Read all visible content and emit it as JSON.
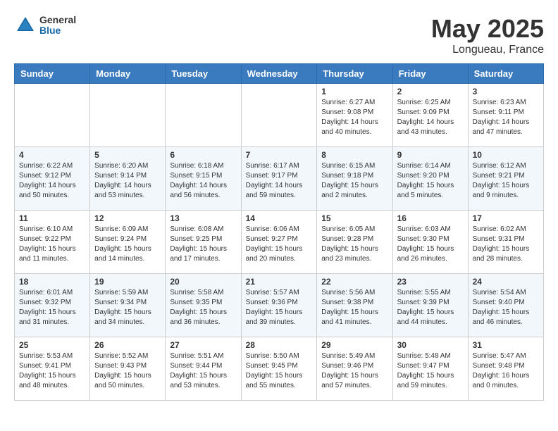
{
  "header": {
    "logo_general": "General",
    "logo_blue": "Blue",
    "title": "May 2025",
    "subtitle": "Longueau, France"
  },
  "calendar": {
    "days_of_week": [
      "Sunday",
      "Monday",
      "Tuesday",
      "Wednesday",
      "Thursday",
      "Friday",
      "Saturday"
    ],
    "weeks": [
      {
        "days": [
          {
            "number": "",
            "info": ""
          },
          {
            "number": "",
            "info": ""
          },
          {
            "number": "",
            "info": ""
          },
          {
            "number": "",
            "info": ""
          },
          {
            "number": "1",
            "info": "Sunrise: 6:27 AM\nSunset: 9:08 PM\nDaylight: 14 hours\nand 40 minutes."
          },
          {
            "number": "2",
            "info": "Sunrise: 6:25 AM\nSunset: 9:09 PM\nDaylight: 14 hours\nand 43 minutes."
          },
          {
            "number": "3",
            "info": "Sunrise: 6:23 AM\nSunset: 9:11 PM\nDaylight: 14 hours\nand 47 minutes."
          }
        ]
      },
      {
        "days": [
          {
            "number": "4",
            "info": "Sunrise: 6:22 AM\nSunset: 9:12 PM\nDaylight: 14 hours\nand 50 minutes."
          },
          {
            "number": "5",
            "info": "Sunrise: 6:20 AM\nSunset: 9:14 PM\nDaylight: 14 hours\nand 53 minutes."
          },
          {
            "number": "6",
            "info": "Sunrise: 6:18 AM\nSunset: 9:15 PM\nDaylight: 14 hours\nand 56 minutes."
          },
          {
            "number": "7",
            "info": "Sunrise: 6:17 AM\nSunset: 9:17 PM\nDaylight: 14 hours\nand 59 minutes."
          },
          {
            "number": "8",
            "info": "Sunrise: 6:15 AM\nSunset: 9:18 PM\nDaylight: 15 hours\nand 2 minutes."
          },
          {
            "number": "9",
            "info": "Sunrise: 6:14 AM\nSunset: 9:20 PM\nDaylight: 15 hours\nand 5 minutes."
          },
          {
            "number": "10",
            "info": "Sunrise: 6:12 AM\nSunset: 9:21 PM\nDaylight: 15 hours\nand 9 minutes."
          }
        ]
      },
      {
        "days": [
          {
            "number": "11",
            "info": "Sunrise: 6:10 AM\nSunset: 9:22 PM\nDaylight: 15 hours\nand 11 minutes."
          },
          {
            "number": "12",
            "info": "Sunrise: 6:09 AM\nSunset: 9:24 PM\nDaylight: 15 hours\nand 14 minutes."
          },
          {
            "number": "13",
            "info": "Sunrise: 6:08 AM\nSunset: 9:25 PM\nDaylight: 15 hours\nand 17 minutes."
          },
          {
            "number": "14",
            "info": "Sunrise: 6:06 AM\nSunset: 9:27 PM\nDaylight: 15 hours\nand 20 minutes."
          },
          {
            "number": "15",
            "info": "Sunrise: 6:05 AM\nSunset: 9:28 PM\nDaylight: 15 hours\nand 23 minutes."
          },
          {
            "number": "16",
            "info": "Sunrise: 6:03 AM\nSunset: 9:30 PM\nDaylight: 15 hours\nand 26 minutes."
          },
          {
            "number": "17",
            "info": "Sunrise: 6:02 AM\nSunset: 9:31 PM\nDaylight: 15 hours\nand 28 minutes."
          }
        ]
      },
      {
        "days": [
          {
            "number": "18",
            "info": "Sunrise: 6:01 AM\nSunset: 9:32 PM\nDaylight: 15 hours\nand 31 minutes."
          },
          {
            "number": "19",
            "info": "Sunrise: 5:59 AM\nSunset: 9:34 PM\nDaylight: 15 hours\nand 34 minutes."
          },
          {
            "number": "20",
            "info": "Sunrise: 5:58 AM\nSunset: 9:35 PM\nDaylight: 15 hours\nand 36 minutes."
          },
          {
            "number": "21",
            "info": "Sunrise: 5:57 AM\nSunset: 9:36 PM\nDaylight: 15 hours\nand 39 minutes."
          },
          {
            "number": "22",
            "info": "Sunrise: 5:56 AM\nSunset: 9:38 PM\nDaylight: 15 hours\nand 41 minutes."
          },
          {
            "number": "23",
            "info": "Sunrise: 5:55 AM\nSunset: 9:39 PM\nDaylight: 15 hours\nand 44 minutes."
          },
          {
            "number": "24",
            "info": "Sunrise: 5:54 AM\nSunset: 9:40 PM\nDaylight: 15 hours\nand 46 minutes."
          }
        ]
      },
      {
        "days": [
          {
            "number": "25",
            "info": "Sunrise: 5:53 AM\nSunset: 9:41 PM\nDaylight: 15 hours\nand 48 minutes."
          },
          {
            "number": "26",
            "info": "Sunrise: 5:52 AM\nSunset: 9:43 PM\nDaylight: 15 hours\nand 50 minutes."
          },
          {
            "number": "27",
            "info": "Sunrise: 5:51 AM\nSunset: 9:44 PM\nDaylight: 15 hours\nand 53 minutes."
          },
          {
            "number": "28",
            "info": "Sunrise: 5:50 AM\nSunset: 9:45 PM\nDaylight: 15 hours\nand 55 minutes."
          },
          {
            "number": "29",
            "info": "Sunrise: 5:49 AM\nSunset: 9:46 PM\nDaylight: 15 hours\nand 57 minutes."
          },
          {
            "number": "30",
            "info": "Sunrise: 5:48 AM\nSunset: 9:47 PM\nDaylight: 15 hours\nand 59 minutes."
          },
          {
            "number": "31",
            "info": "Sunrise: 5:47 AM\nSunset: 9:48 PM\nDaylight: 16 hours\nand 0 minutes."
          }
        ]
      }
    ]
  }
}
